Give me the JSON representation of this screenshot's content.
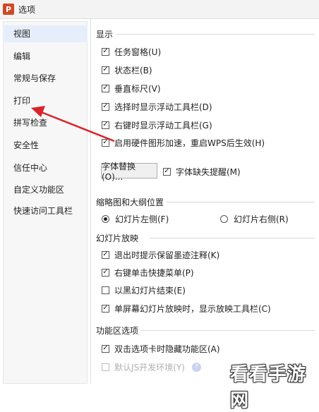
{
  "window": {
    "title": "选项",
    "app_icon_letter": "P",
    "accent": "#d24726"
  },
  "sidebar": {
    "items": [
      {
        "label": "视图",
        "active": true
      },
      {
        "label": "编辑"
      },
      {
        "label": "常规与保存"
      },
      {
        "label": "打印"
      },
      {
        "label": "拼写检查"
      },
      {
        "label": "安全性"
      },
      {
        "label": "信任中心"
      },
      {
        "label": "自定义功能区"
      },
      {
        "label": "快速访问工具栏"
      }
    ]
  },
  "display": {
    "title": "显示",
    "options": [
      {
        "label": "任务窗格(U)",
        "checked": true
      },
      {
        "label": "状态栏(B)",
        "checked": true
      },
      {
        "label": "垂直标尺(V)",
        "checked": true
      },
      {
        "label": "选择时显示浮动工具栏(D)",
        "checked": true
      },
      {
        "label": "右键时显示浮动工具栏(G)",
        "checked": true
      },
      {
        "label": "启用硬件图形加速，重启WPS后生效(H)",
        "checked": true
      }
    ],
    "font_replace_button": "字体替换(O)...",
    "font_missing_reminder": {
      "label": "字体缺失提醒(M)",
      "checked": true
    }
  },
  "thumbnail": {
    "title": "缩略图和大纲位置",
    "left_option": "幻灯片左侧(F)",
    "right_option": "幻灯片右侧(R)",
    "selected": "left"
  },
  "slideshow": {
    "title": "幻灯片放映",
    "options": [
      {
        "label": "退出时提示保留墨迹注释(K)",
        "checked": true
      },
      {
        "label": "右键单击快捷菜单(P)",
        "checked": true
      },
      {
        "label": "以黑幻灯片结束(E)",
        "checked": false
      },
      {
        "label": "单屏幕幻灯片放映时，显示放映工具栏(C)",
        "checked": true
      }
    ]
  },
  "ribbon": {
    "title": "功能区选项",
    "options": [
      {
        "label": "双击选项卡时隐藏功能区(A)",
        "checked": true
      },
      {
        "label": "默认JS开发环境(Y)",
        "checked": false,
        "disabled": true
      }
    ],
    "help_glyph": "?"
  },
  "watermark": {
    "text": "看看手游网"
  },
  "annotation": {
    "arrow_color": "#d9242b"
  }
}
